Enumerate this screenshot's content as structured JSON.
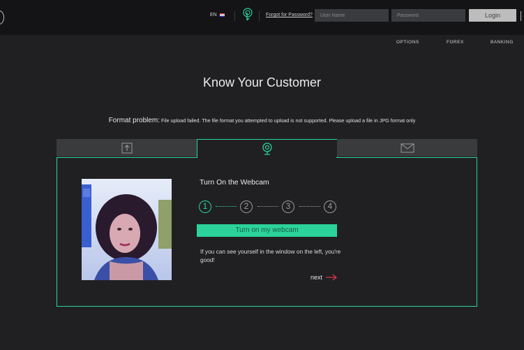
{
  "header": {
    "language": "EN",
    "forgot_password": "Forgot for Password?",
    "username_placeholder": "User Name",
    "password_placeholder": "Password",
    "login_label": "Login"
  },
  "nav": {
    "items": [
      {
        "label": "OPTIONS"
      },
      {
        "label": "FOREX"
      },
      {
        "label": "BANKING"
      }
    ]
  },
  "main": {
    "title": "Know Your Customer",
    "format_label": "Format problem:",
    "format_message": "File upload failed. The file format you attempted to upload is not supported. Please upload a file in JPG format only"
  },
  "tabs": [
    {
      "icon": "upload-icon"
    },
    {
      "icon": "webcam-icon",
      "active": true
    },
    {
      "icon": "envelope-icon"
    }
  ],
  "webcam_step": {
    "title": "Turn On the Webcam",
    "steps": [
      "1",
      "2",
      "3",
      "4"
    ],
    "current_step": 1,
    "button_label": "Turn on my webcam",
    "hint": "If you can see yourself in the window on the left, you're good!",
    "next_label": "next"
  },
  "colors": {
    "accent": "#2bd39a",
    "background": "#202022",
    "topbar": "#141416",
    "next_arrow": "#e0314b"
  }
}
